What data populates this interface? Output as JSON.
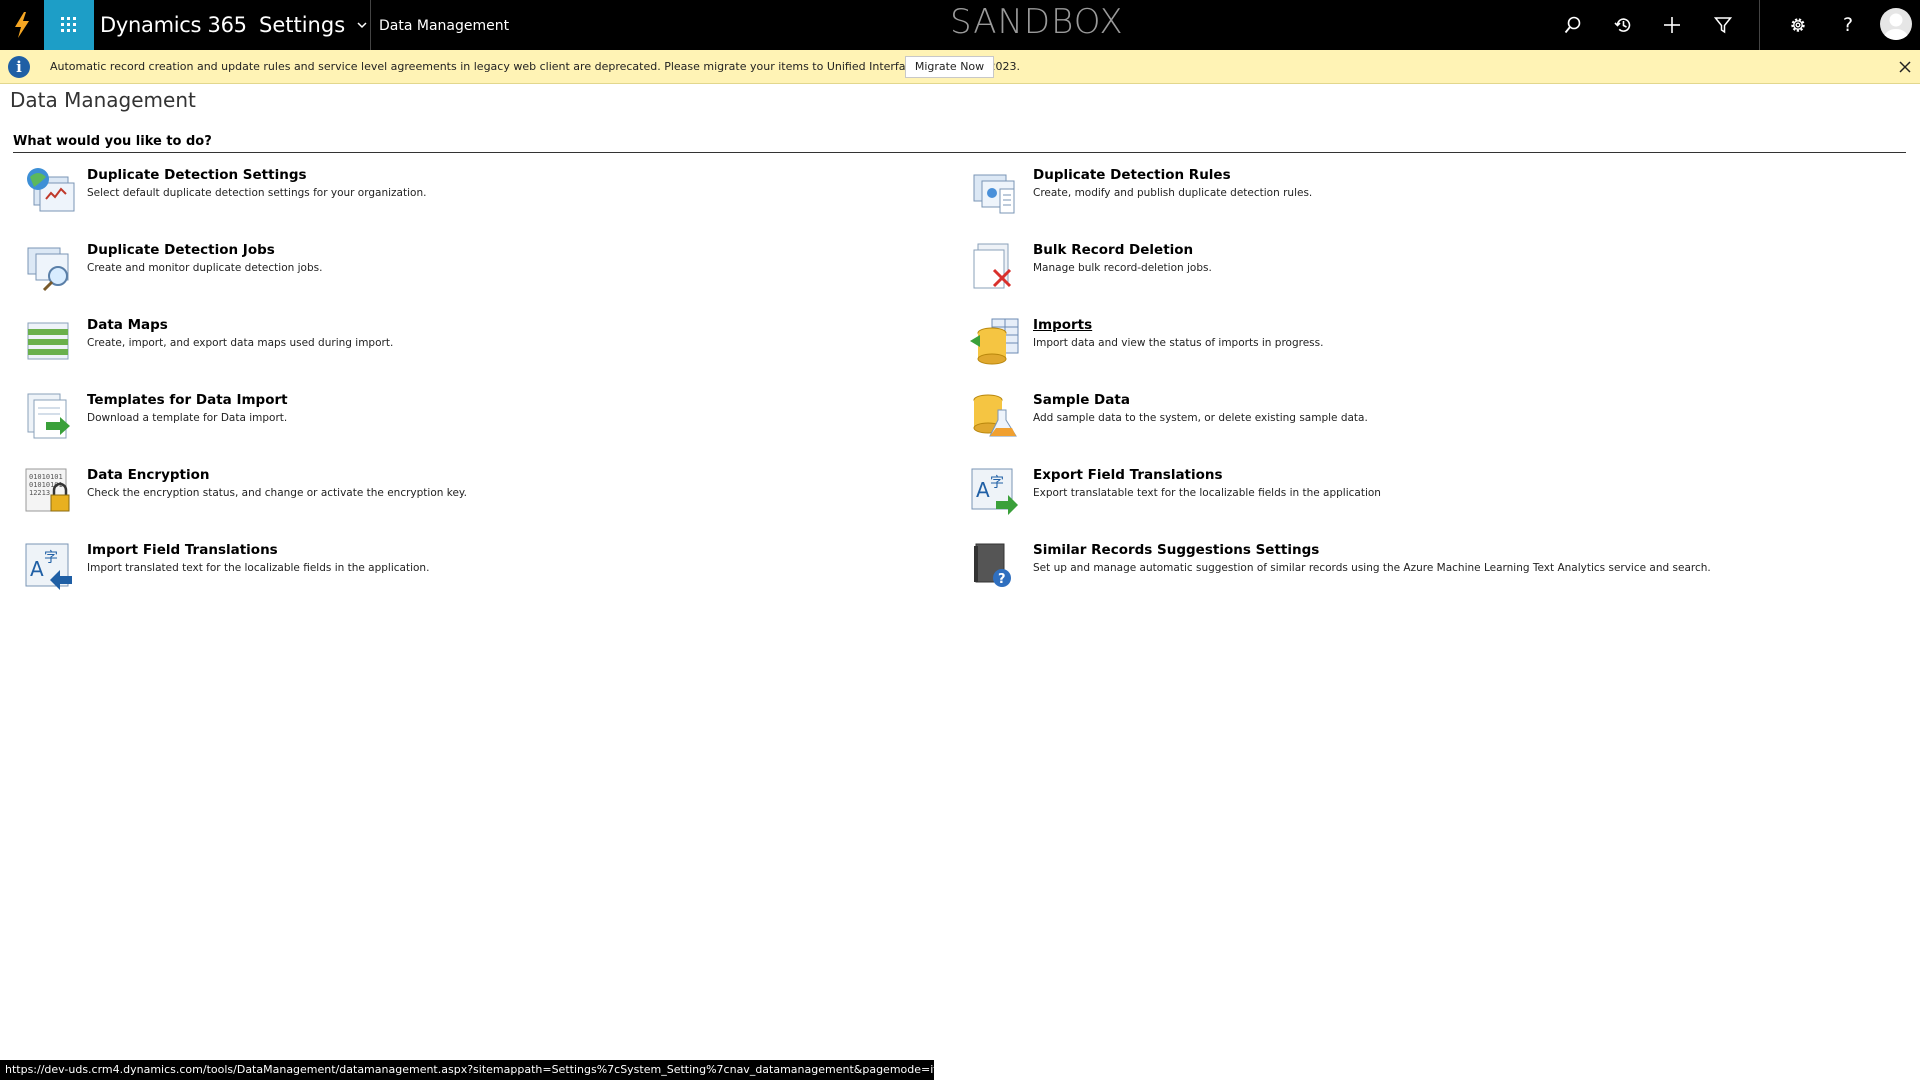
{
  "topbar": {
    "app_name": "Dynamics 365",
    "area": "Settings",
    "breadcrumb": "Data Management",
    "environment_label": "SANDBOX",
    "accent_color": "#1d9ec7"
  },
  "notification": {
    "text": "Automatic record creation and update rules and service level agreements in legacy web client are deprecated. Please migrate your items to Unified Interface by 01, April 2023.",
    "button_label": "Migrate Now",
    "background": "#fff3b5"
  },
  "page": {
    "title": "Data Management",
    "section_header": "What would you like to do?"
  },
  "items": [
    {
      "title": "Duplicate Detection Settings",
      "desc": "Select default duplicate detection settings for your organization.",
      "icon": "duplicate-settings-icon"
    },
    {
      "title": "Duplicate Detection Rules",
      "desc": "Create, modify and publish duplicate detection rules.",
      "icon": "duplicate-rules-icon"
    },
    {
      "title": "Duplicate Detection Jobs",
      "desc": "Create and monitor duplicate detection jobs.",
      "icon": "duplicate-jobs-icon"
    },
    {
      "title": "Bulk Record Deletion",
      "desc": "Manage bulk record-deletion jobs.",
      "icon": "bulk-delete-icon"
    },
    {
      "title": "Data Maps",
      "desc": "Create, import, and export data maps used during import.",
      "icon": "data-maps-icon"
    },
    {
      "title": "Imports",
      "desc": "Import data and view the status of imports in progress.",
      "icon": "imports-icon"
    },
    {
      "title": "Templates for Data Import",
      "desc": "Download a template for Data import.",
      "icon": "templates-icon"
    },
    {
      "title": "Sample Data",
      "desc": "Add sample data to the system, or delete existing sample data.",
      "icon": "sample-data-icon"
    },
    {
      "title": "Data Encryption",
      "desc": "Check the encryption status, and change or activate the encryption key.",
      "icon": "data-encryption-icon"
    },
    {
      "title": "Export Field Translations",
      "desc": "Export translatable text for the localizable fields in the application",
      "icon": "export-translations-icon"
    },
    {
      "title": "Import Field Translations",
      "desc": "Import translated text for the localizable fields in the application.",
      "icon": "import-translations-icon"
    },
    {
      "title": "Similar Records Suggestions Settings",
      "desc": "Set up and manage automatic suggestion of similar records using the Azure Machine Learning Text Analytics service and search.",
      "icon": "similar-records-icon"
    }
  ],
  "statusbar": {
    "url": "https://dev-uds.crm4.dynamics.com/tools/DataManagement/datamanagement.aspx?sitemappath=Settings%7cSystem_Setting%7cnav_datamanagement&pagemode=iframe#"
  }
}
